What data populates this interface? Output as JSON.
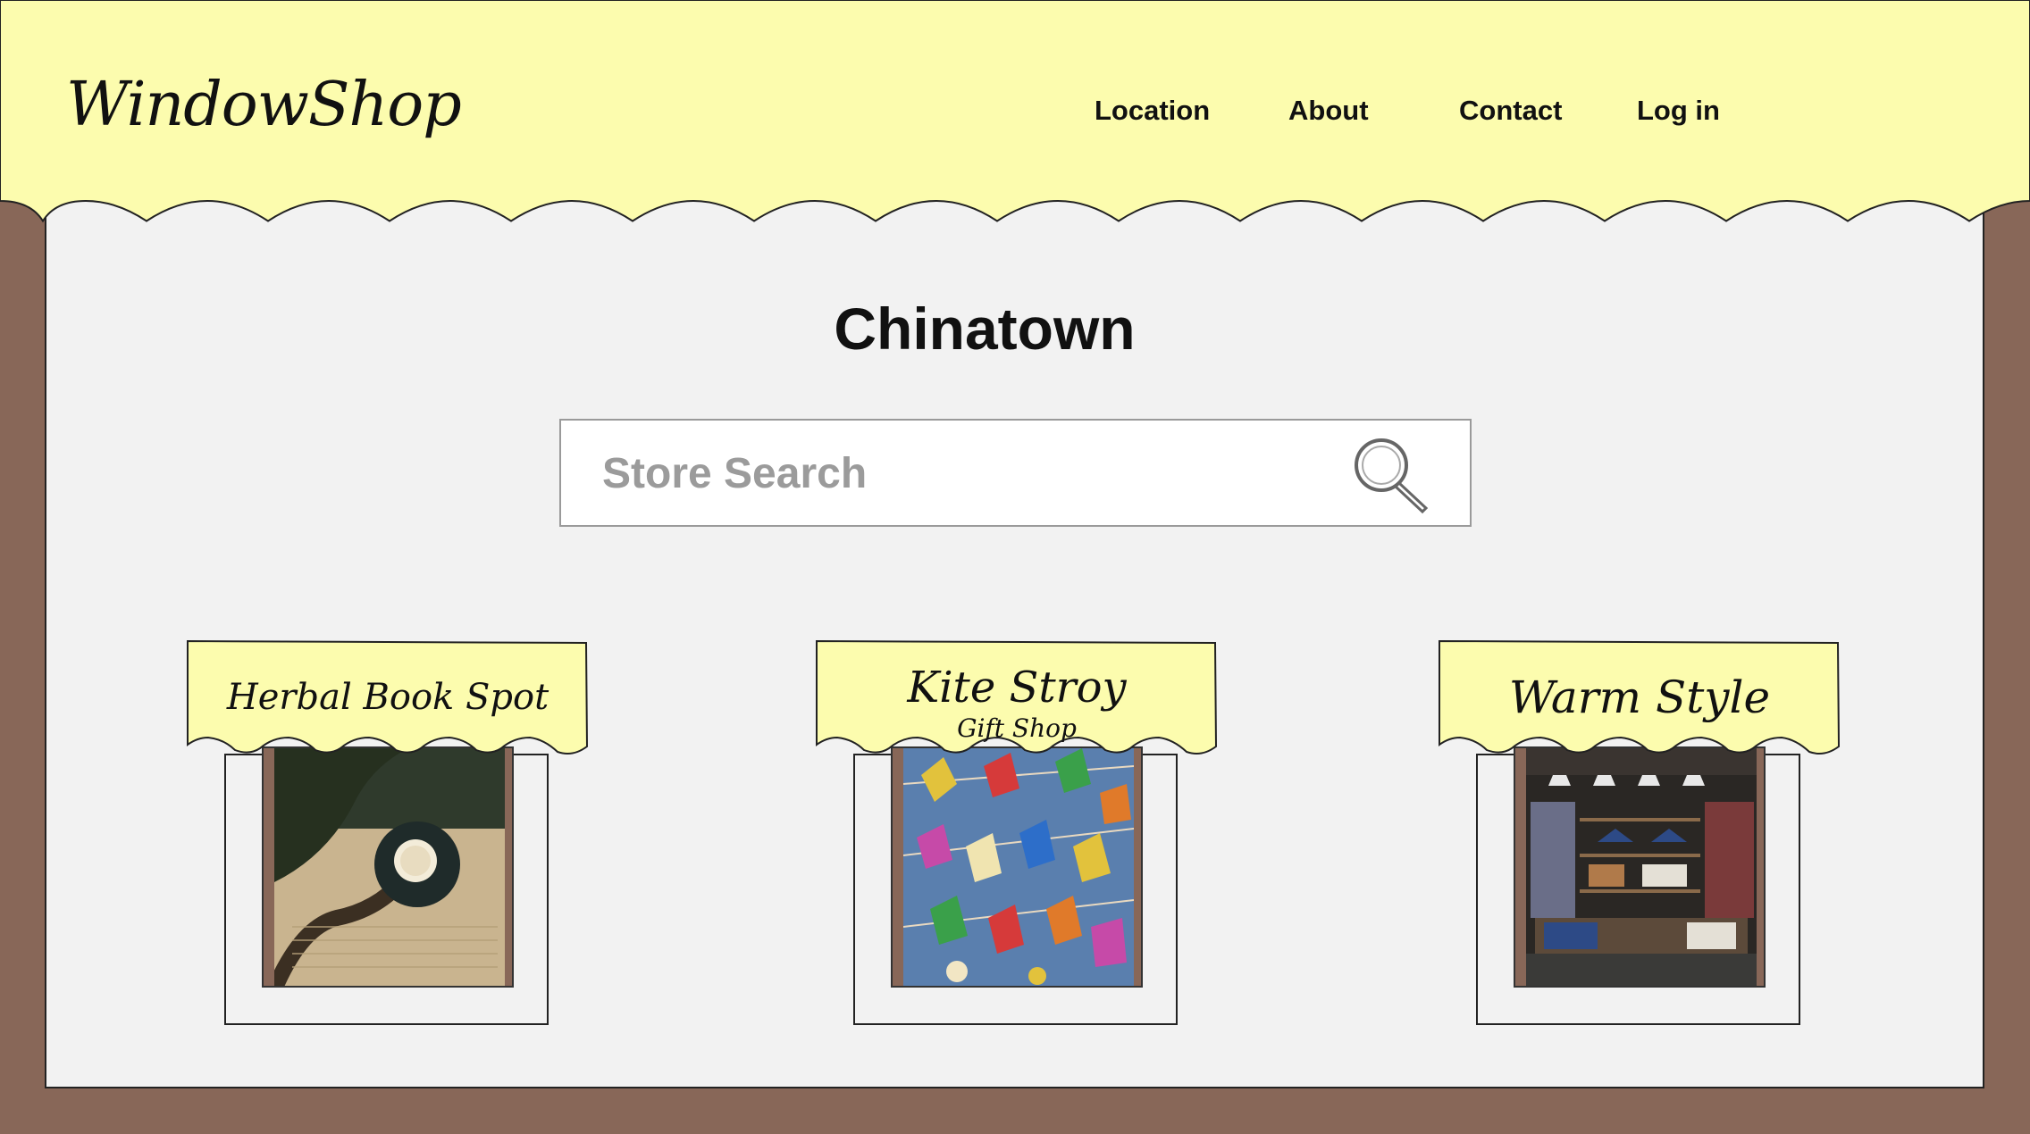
{
  "header": {
    "logo": "WindowShop",
    "nav": [
      "Location",
      "About",
      "Contact",
      "Log in"
    ]
  },
  "main": {
    "title": "Chinatown",
    "search": {
      "placeholder": "Store Search",
      "value": ""
    }
  },
  "stores": [
    {
      "name": "Herbal Book Spot",
      "subtitle": "",
      "image": "tea-cup-on-book"
    },
    {
      "name": "Kite Stroy",
      "subtitle": "Gift Shop",
      "image": "colorful-kites"
    },
    {
      "name": "Warm Style",
      "subtitle": "",
      "image": "clothing-store-interior"
    }
  ],
  "colors": {
    "awning": "#fcfcae",
    "wood": "#886758",
    "panel": "#f2f2f2"
  }
}
